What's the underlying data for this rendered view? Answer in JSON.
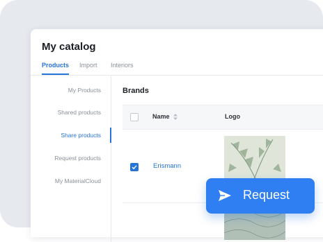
{
  "catalog": {
    "title": "My catalog"
  },
  "tabs": [
    {
      "label": "Products",
      "active": true
    },
    {
      "label": "Import",
      "active": false
    },
    {
      "label": "Interiors",
      "active": false
    }
  ],
  "sidebar": {
    "items": [
      {
        "label": "My Products",
        "active": false
      },
      {
        "label": "Shared products",
        "active": false
      },
      {
        "label": "Share products",
        "active": true
      },
      {
        "label": "Request products",
        "active": false
      },
      {
        "label": "My MaterialCloud",
        "active": false
      }
    ]
  },
  "brands": {
    "title": "Brands",
    "columns": {
      "name": "Name",
      "logo": "Logo"
    },
    "rows": [
      {
        "name": "Erismann",
        "checked": true,
        "logo_icon": "tropical-leaves-wallpaper-image"
      }
    ]
  },
  "request_button": {
    "label": "Request",
    "icon": "send-icon"
  },
  "colors": {
    "accent": "#2674d9",
    "button": "#2f7ff2",
    "backdrop": "#e6e9ee"
  }
}
